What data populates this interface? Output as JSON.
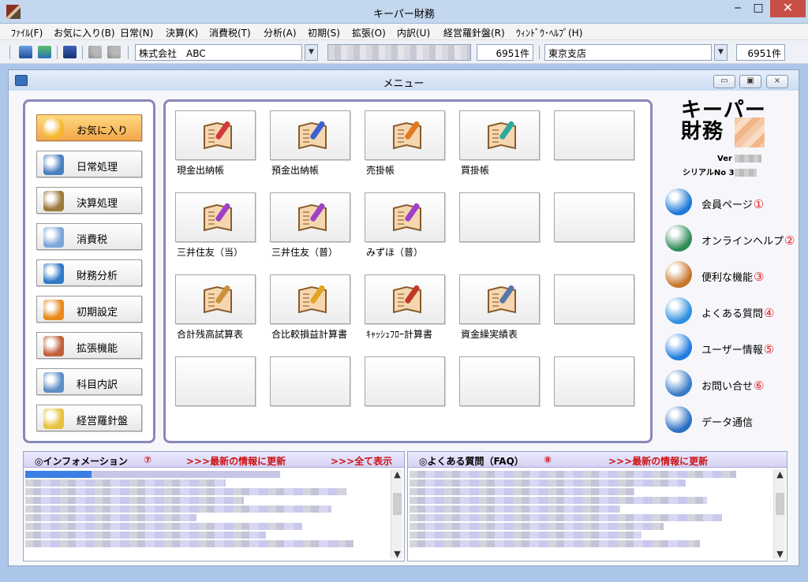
{
  "window": {
    "title": "キーパー財務",
    "min": "‒",
    "max": "□",
    "close": "✕"
  },
  "menubar": [
    "ﾌｧｲﾙ(F)",
    "お気に入り(B)",
    "日常(N)",
    "決算(K)",
    "消費税(T)",
    "分析(A)",
    "初期(S)",
    "拡張(O)",
    "内訳(U)",
    "経営羅針盤(R)",
    "ｳｨﾝﾄﾞｳ･ﾍﾙﾌﾟ(H)"
  ],
  "toolbar": {
    "company": "株式会社　ABC",
    "count1": "6951件",
    "branch": "東京支店",
    "count2": "6951件",
    "drop": "▼"
  },
  "inner": {
    "title": "メニュー",
    "min": "▭",
    "max": "▣",
    "close": "⨯"
  },
  "categories": [
    {
      "label": "お気に入り",
      "icon": "star-icon",
      "color": "#f5b82e"
    },
    {
      "label": "日常処理",
      "icon": "daily-notebook-icon",
      "color": "#4a7fc1"
    },
    {
      "label": "決算処理",
      "icon": "clipboard-icon",
      "color": "#9c7a3c"
    },
    {
      "label": "消費税",
      "icon": "tax-document-icon",
      "color": "#7aa7d8"
    },
    {
      "label": "財務分析",
      "icon": "chart-prism-icon",
      "color": "#2f79c8"
    },
    {
      "label": "初期設定",
      "icon": "gear-icon",
      "color": "#e88a1a"
    },
    {
      "label": "拡張機能",
      "icon": "extension-icon",
      "color": "#c0603b"
    },
    {
      "label": "科目内訳",
      "icon": "documents-icon",
      "color": "#5e8ec7"
    },
    {
      "label": "経営羅針盤",
      "icon": "compass-icon",
      "color": "#e7c23d"
    }
  ],
  "tiles": [
    {
      "label": "現金出納帳",
      "icon": "cash-book-icon",
      "pen": "#d23a3a"
    },
    {
      "label": "預金出納帳",
      "icon": "deposit-book-icon",
      "pen": "#3a5fd2"
    },
    {
      "label": "売掛帳",
      "icon": "receivable-book-icon",
      "pen": "#e07a20"
    },
    {
      "label": "買掛帳",
      "icon": "payable-book-icon",
      "pen": "#2aa9a0"
    },
    {
      "label": "",
      "icon": ""
    },
    {
      "label": "三井住友（当）",
      "icon": "bank-book-icon",
      "pen": "#a040c8"
    },
    {
      "label": "三井住友（普）",
      "icon": "bank-book-icon",
      "pen": "#a040c8"
    },
    {
      "label": "みずほ（普）",
      "icon": "bank-book-icon",
      "pen": "#a040c8"
    },
    {
      "label": "",
      "icon": ""
    },
    {
      "label": "",
      "icon": ""
    },
    {
      "label": "合計残高試算表",
      "icon": "trial-balance-icon",
      "pen": "#c9913a"
    },
    {
      "label": "合比較損益計算書",
      "icon": "magnifier-document-icon",
      "pen": "#e1a521"
    },
    {
      "label": "ｷｬｯｼｭﾌﾛｰ計算書",
      "icon": "calendar-clock-icon",
      "pen": "#c0392b"
    },
    {
      "label": "資金繰実績表",
      "icon": "calculator-document-icon",
      "pen": "#5777a8"
    },
    {
      "label": "",
      "icon": ""
    },
    {
      "label": "",
      "icon": ""
    },
    {
      "label": "",
      "icon": ""
    },
    {
      "label": "",
      "icon": ""
    },
    {
      "label": "",
      "icon": ""
    },
    {
      "label": "",
      "icon": ""
    }
  ],
  "brand": {
    "line1": "キーパー",
    "line2": "財務",
    "ver": "Ver",
    "serial": "シリアルNo  3"
  },
  "links": [
    {
      "label": "会員ページ",
      "num": "①",
      "icon": "member-icon",
      "color": "#1d78d8"
    },
    {
      "label": "オンラインヘルプ",
      "num": "②",
      "icon": "online-help-globe-icon",
      "color": "#2e8b57"
    },
    {
      "label": "便利な機能",
      "num": "③",
      "icon": "tools-icon",
      "color": "#c8752b"
    },
    {
      "label": "よくある質問",
      "num": "④",
      "icon": "faq-icon",
      "color": "#2f8fe0"
    },
    {
      "label": "ユーザー情報",
      "num": "⑤",
      "icon": "info-icon",
      "color": "#1f7be0"
    },
    {
      "label": "お問い合せ",
      "num": "⑥",
      "icon": "mail-icon",
      "color": "#3a7bc8"
    },
    {
      "label": "データ通信",
      "num": "",
      "icon": "data-sync-globe-icon",
      "color": "#2b6fc3"
    }
  ],
  "info_pane": {
    "title": "◎インフォメーション",
    "num": "⑦",
    "update": ">>>最新の情報に更新",
    "show_all": ">>>全て表示"
  },
  "faq_pane": {
    "title": "◎よくある質問（FAQ）",
    "num": "⑧",
    "update": ">>>最新の情報に更新"
  }
}
